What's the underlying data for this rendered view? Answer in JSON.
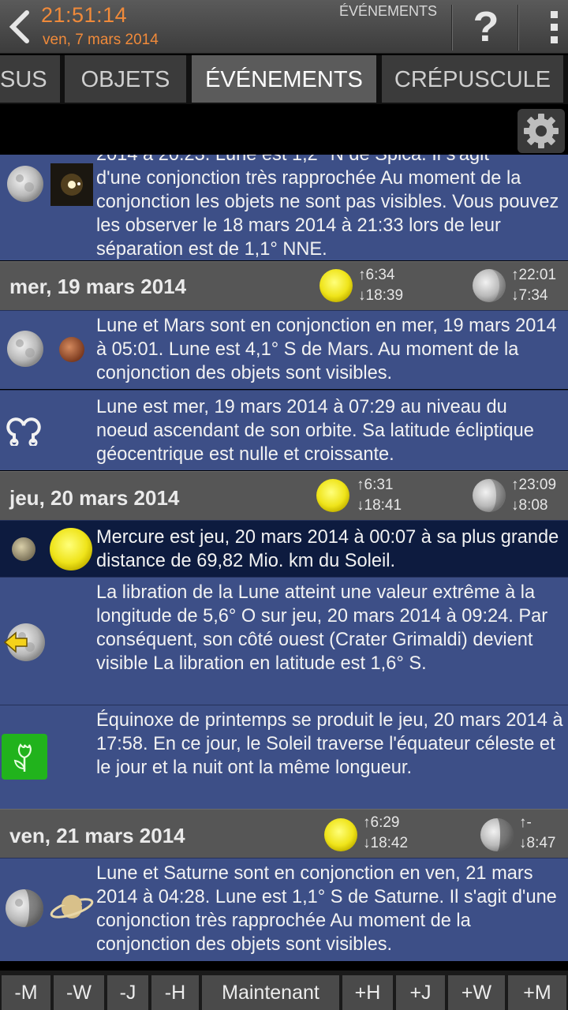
{
  "header": {
    "time": "21:51:14",
    "date": "ven, 7 mars 2014",
    "screen_label": "ÉVÉNEMENTS",
    "help_label": "?",
    "accent_color": "#f08a3a"
  },
  "tabs": [
    {
      "label": "SUS"
    },
    {
      "label": "OBJETS"
    },
    {
      "label": "ÉVÉNEMENTS"
    },
    {
      "label": "CRÉPUSCULE"
    }
  ],
  "events_top": {
    "clipped_line": "2014 à 20:23. Lune est 1,2° N de Spica. Il s'agit",
    "text": "d'une conjonction très rapprochée Au moment de la conjonction les objets ne sont pas visibles. Vous pouvez les observer le 18 mars 2014 à 21:33 lors de leur séparation est de 1,1° NNE."
  },
  "days": [
    {
      "title": "mer, 19 mars 2014",
      "sun_rise": "↑6:34",
      "sun_set": "↓18:39",
      "moon_rise": "↑22:01",
      "moon_set": "↓7:34",
      "events": [
        {
          "text": "Lune et Mars sont en conjonction en mer, 19 mars 2014 à 05:01. Lune est 4,1° S de Mars. Au moment de la conjonction des objets sont visibles."
        },
        {
          "text": "Lune est mer, 19 mars 2014 à 07:29 au niveau du noeud ascendant de son orbite. Sa latitude écliptique géocentrique est nulle et croissante."
        }
      ]
    },
    {
      "title": "jeu, 20 mars 2014",
      "sun_rise": "↑6:31",
      "sun_set": "↓18:41",
      "moon_rise": "↑23:09",
      "moon_set": "↓8:08",
      "events": [
        {
          "text": "Mercure est jeu, 20 mars 2014 à 00:07 à sa plus grande distance de 69,82 Mio. km du Soleil."
        },
        {
          "text": "La libration de la Lune atteint une valeur extrême à la longitude de 5,6° O sur jeu, 20 mars 2014 à 09:24. Par conséquent, son côté ouest (Crater Grimaldi) devient visible La libration en latitude est 1,6° S."
        },
        {
          "text": "Équinoxe de printemps se produit le jeu, 20 mars 2014 à 17:58. En ce jour, le Soleil traverse l'équateur céleste et le jour et la nuit ont la même longueur."
        }
      ]
    },
    {
      "title": "ven, 21 mars 2014",
      "sun_rise": "↑6:29",
      "sun_set": "↓18:42",
      "moon_rise": "↑-",
      "moon_set": "↓8:47",
      "events": [
        {
          "text": "Lune et Saturne sont en conjonction en ven, 21 mars 2014 à 04:28. Lune est 1,1° S de Saturne. Il s'agit d'une conjonction très rapprochée Au moment de la conjonction des objets sont visibles."
        }
      ]
    }
  ],
  "bottom_bar": [
    {
      "label": "-M"
    },
    {
      "label": "-W"
    },
    {
      "label": "-J"
    },
    {
      "label": "-H"
    },
    {
      "label": "Maintenant"
    },
    {
      "label": "+H"
    },
    {
      "label": "+J"
    },
    {
      "label": "+W"
    },
    {
      "label": "+M"
    }
  ],
  "colors": {
    "event_bg": "#3d4f87",
    "event_highlight_bg": "#0d1b3f",
    "day_header_bg": "#565656",
    "sun": "#f2ea1a"
  }
}
